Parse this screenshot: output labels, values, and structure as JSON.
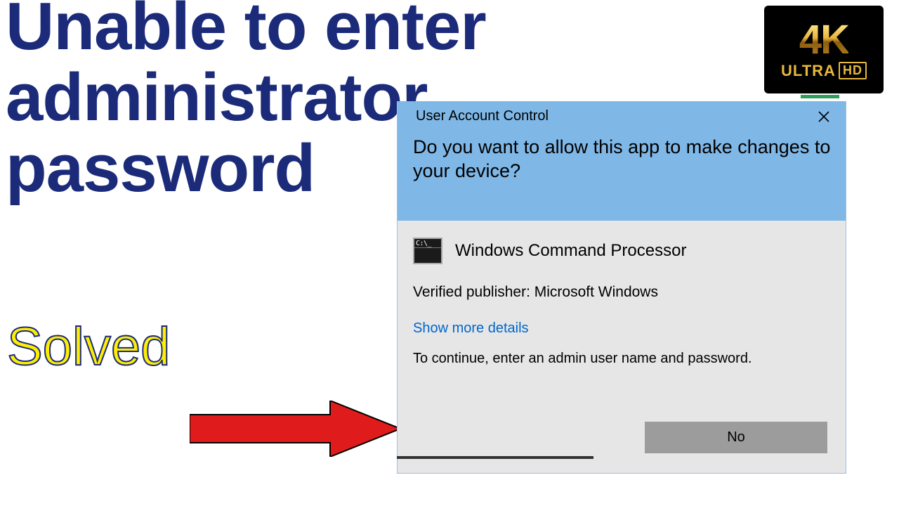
{
  "title_lines": "Unable to enter\nadministrator\npassword",
  "solved_label": "Solved",
  "badge": {
    "top": "4K",
    "bottom": "ULTRA",
    "hd": "HD"
  },
  "uac": {
    "window_title": "User Account Control",
    "question": "Do you want to allow this app to make changes to your device?",
    "app_name": "Windows Command Processor",
    "publisher": "Verified publisher: Microsoft Windows",
    "show_more": "Show more details",
    "continue": "To continue, enter an admin user name and password.",
    "no_button": "No"
  },
  "icons": {
    "close": "close-icon",
    "cmd": "cmd-icon",
    "arrow": "right-arrow-icon"
  }
}
